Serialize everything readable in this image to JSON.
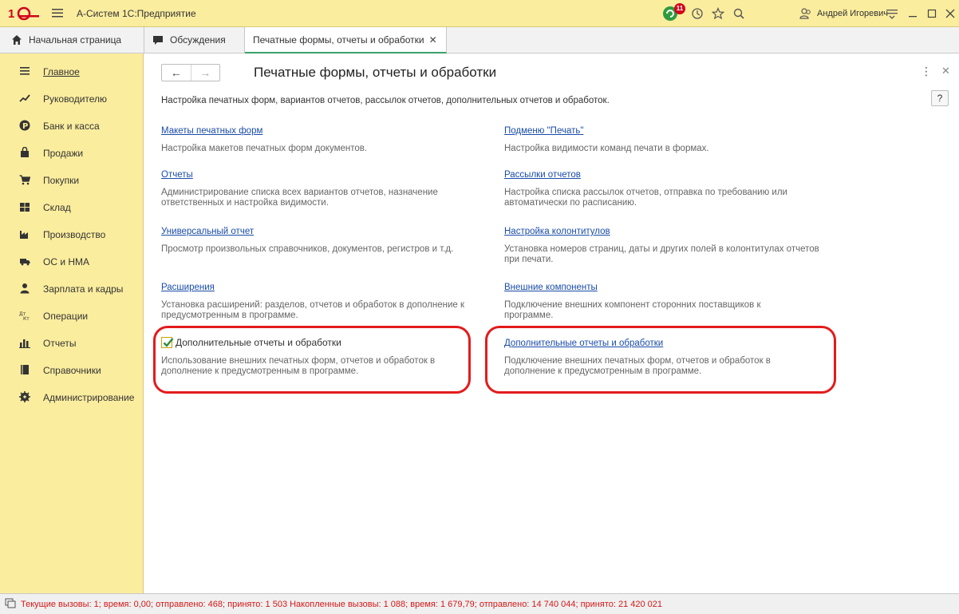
{
  "titlebar": {
    "app_title": "А-Систем 1С:Предприятие",
    "notifications_count": "11",
    "user_name": "Андрей Игоревич"
  },
  "tabs": [
    {
      "label": "Начальная страница",
      "icon": "home-icon"
    },
    {
      "label": "Обсуждения",
      "icon": "chat-icon"
    },
    {
      "label": "Печатные формы, отчеты и обработки",
      "icon": "",
      "active": true
    }
  ],
  "sidebar": {
    "items": [
      {
        "label": "Главное",
        "icon": "menu-icon"
      },
      {
        "label": "Руководителю",
        "icon": "trend-icon"
      },
      {
        "label": "Банк и касса",
        "icon": "ruble-icon"
      },
      {
        "label": "Продажи",
        "icon": "bag-icon"
      },
      {
        "label": "Покупки",
        "icon": "cart-icon"
      },
      {
        "label": "Склад",
        "icon": "warehouse-icon"
      },
      {
        "label": "Производство",
        "icon": "factory-icon"
      },
      {
        "label": "ОС и НМА",
        "icon": "truck-icon"
      },
      {
        "label": "Зарплата и кадры",
        "icon": "person-icon"
      },
      {
        "label": "Операции",
        "icon": "operations-icon"
      },
      {
        "label": "Отчеты",
        "icon": "bar-chart-icon"
      },
      {
        "label": "Справочники",
        "icon": "book-icon"
      },
      {
        "label": "Администрирование",
        "icon": "gear-icon"
      }
    ]
  },
  "main": {
    "title": "Печатные формы, отчеты и обработки",
    "subtitle": "Настройка печатных форм, вариантов отчетов, рассылок отчетов, дополнительных отчетов и обработок.",
    "help_label": "?",
    "left": [
      {
        "link": "Макеты печатных форм",
        "desc": "Настройка макетов печатных форм документов."
      },
      {
        "link": "Отчеты",
        "desc": "Администрирование списка всех вариантов отчетов, назначение ответственных и настройка видимости."
      },
      {
        "link": "Универсальный отчет",
        "desc": "Просмотр произвольных справочников, документов, регистров и т.д."
      },
      {
        "link": "Расширения",
        "desc": "Установка расширений: разделов, отчетов и обработок в дополнение к предусмотренным в программе."
      },
      {
        "checkbox_label": "Дополнительные отчеты и обработки",
        "checked": true,
        "desc": "Использование внешних печатных форм, отчетов и обработок в дополнение к предусмотренным в программе."
      }
    ],
    "right": [
      {
        "link": "Подменю \"Печать\"",
        "desc": "Настройка видимости команд печати в формах."
      },
      {
        "link": "Рассылки отчетов",
        "desc": "Настройка списка рассылок отчетов, отправка по требованию или автоматически по расписанию."
      },
      {
        "link": "Настройка колонтитулов",
        "desc": "Установка номеров страниц, даты и других полей в колонтитулах отчетов при печати."
      },
      {
        "link": "Внешние компоненты",
        "desc": "Подключение внешних компонент сторонних поставщиков к программе."
      },
      {
        "link": "Дополнительные отчеты и обработки",
        "desc": "Подключение внешних печатных форм, отчетов и обработок в дополнение к предусмотренным в программе."
      }
    ]
  },
  "statusbar": {
    "text": "Текущие вызовы: 1; время: 0,00; отправлено: 468; принято: 1 503   Накопленные вызовы: 1 088; время: 1 679,79; отправлено: 14 740 044; принято: 21 420 021"
  },
  "colors": {
    "accent_yellow": "#fbed9e",
    "link_blue": "#1a4ca8",
    "highlight_red": "#e31b1b",
    "status_red": "#d41818"
  }
}
